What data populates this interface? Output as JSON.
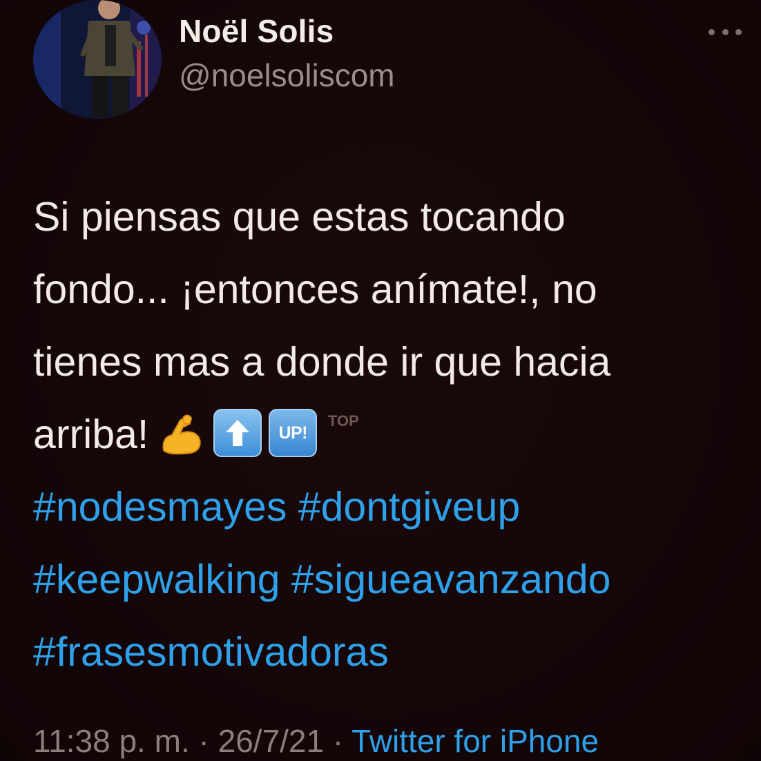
{
  "tweet": {
    "author": {
      "display_name": "Noël Solis",
      "handle": "@noelsoliscom"
    },
    "more_icon": "more-horizontal-icon",
    "text_lines": [
      "Si piensas que estas tocando",
      "fondo... ¡entonces anímate!, no",
      "tienes mas a donde ir que hacia",
      "arriba!"
    ],
    "emojis": {
      "flexed_biceps": "flexed-biceps-icon",
      "up_arrow": "up-arrow-icon",
      "up_button_label": "UP!",
      "top_arrow_label": "TOP"
    },
    "hashtags": [
      [
        "#nodesmayes",
        "#dontgiveup"
      ],
      [
        "#keepwalking",
        "#sigueavanzando"
      ],
      [
        "#frasesmotivadoras"
      ]
    ],
    "meta": {
      "time": "11:38 p. m.",
      "separator": "·",
      "date": "26/7/21",
      "source": "Twitter for iPhone"
    }
  },
  "colors": {
    "background": "#140608",
    "text": "#f3ebe6",
    "muted": "#8b7f7b",
    "link": "#2ea1ea"
  }
}
